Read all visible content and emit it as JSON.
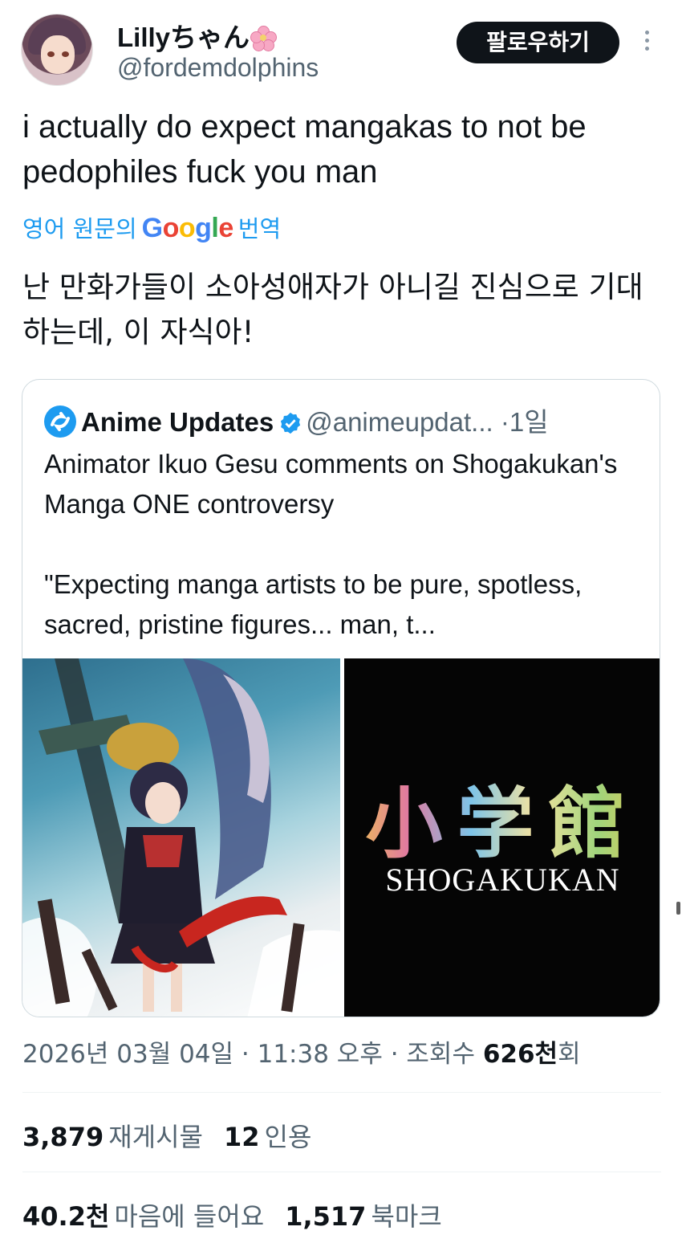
{
  "author": {
    "display_name": "Lillyちゃん",
    "handle": "@fordemdolphins",
    "follow_label": "팔로우하기"
  },
  "tweet": {
    "text": "i actually do expect mangakas to not be pedophiles fuck you man",
    "translate_prefix": "영어 원문의",
    "translate_brand": "Google",
    "translate_suffix": "번역",
    "translated_text": "난 만화가들이 소아성애자가 아니길 진심으로 기대하는데, 이 자식아!"
  },
  "quote": {
    "name": "Anime Updates",
    "handle": "@animeupdat...",
    "separator": "·",
    "time": "1일",
    "text": "Animator Ikuo Gesu comments on Shogakukan's Manga ONE controversy\n\n\"Expecting manga artists to be pure, spotless, sacred, pristine figures... man, t...",
    "image_right_kanji": "小学館",
    "image_right_caption": "SHOGAKUKAN"
  },
  "meta": {
    "timestamp": "2026년 03월 04일 · 11:38 오후 · 조회수",
    "views_num": "626천",
    "views_suffix": "회"
  },
  "stats": {
    "retweets": "3,879",
    "retweets_label": "재게시물",
    "quotes": "12",
    "quotes_label": "인용",
    "likes": "40.2천",
    "likes_label": "마음에 들어요",
    "bookmarks": "1,517",
    "bookmarks_label": "북마크"
  },
  "colors": {
    "link": "#1d9bf0",
    "secondary_text": "#536471",
    "primary_text": "#0f1419",
    "button_bg": "#0f1419"
  }
}
